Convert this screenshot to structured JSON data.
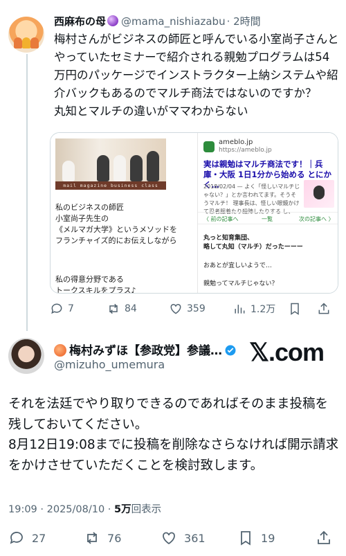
{
  "reply": {
    "author_name": "西麻布の母",
    "author_handle": "@mama_nishiazabu",
    "time": "· 2時間",
    "text": "梅村さんがビジネスの師匠と呼んでいる小室尚子さんとやっていたセミナーで紹介される親勉プログラムは54万円のパッケージでインストラクター上納システムや紹介バックもあるのでマルチ商法ではないのですか？\n丸知とマルチの違いがママわからない",
    "media": {
      "left_banner": "mail magazine business class",
      "left_text_1": "私のビジネスの師匠\n小室尚子先生の\n《メルマガ大学》というメソッドを\nフランチャイズ的にお伝えしながら",
      "left_text_2": "私の得意分野である\nトークスキルをプラス♪",
      "ameblo_domain": "ameblo.jp",
      "ameblo_url": "https://ameblo.jp",
      "ameblo_title": "実は親勉はマルチ商法です！｜兵庫・大阪 1日1分から始める とにかく…",
      "ameblo_snippet": "2018/02/04 — よく「怪しいマルチじゃない？」とか言われてます。そうそうマルチ！ 理事長は、怪しい眼鏡かけて忍者服着たり殺陣したりする し、",
      "nav_prev": "〈 前の記事へ",
      "nav_list": "一覧",
      "nav_next": "次の記事へ 〉",
      "ameblo_body_1": "丸っと知育集団、\n略して丸知（マルチ）だったーーー",
      "ameblo_body_2": "おあとが宜しいようで…",
      "ameblo_body_3": "親勉ってマルチじゃない？"
    },
    "actions": {
      "replies": "7",
      "reposts": "84",
      "likes": "359",
      "views": "1.2万"
    }
  },
  "main": {
    "author_name": "梅村みずほ【参政党】参議…",
    "author_handle": "@mizuho_umemura",
    "brand": "𝕏.com",
    "text": "それを法廷でやり取りできるのであればそのまま投稿を残しておいてください。\n8月12日19:08までに投稿を削除なさらなければ開示請求をかけさせていただくことを検討致します。",
    "time": "19:09 · 2025/08/10 · ",
    "views_count": "5万",
    "views_label": "回表示",
    "actions": {
      "replies": "27",
      "reposts": "76",
      "likes": "361",
      "bookmarks": "19"
    }
  },
  "colors": {
    "text_primary": "#0f1419",
    "text_secondary": "#536471",
    "verified": "#1d9bf0",
    "ameba_green": "#2d8c3c",
    "link_blue": "#1a0dab"
  }
}
